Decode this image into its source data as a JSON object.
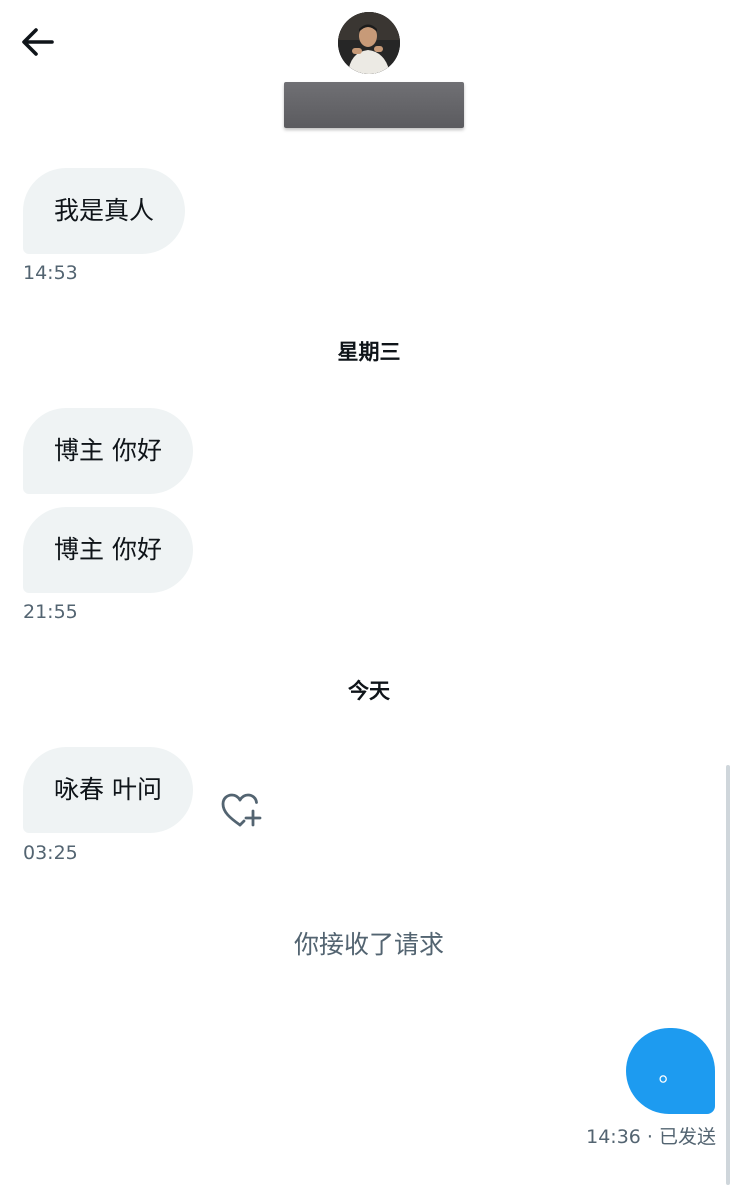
{
  "header": {
    "back_icon": "arrow-left-icon",
    "avatar_icon": "user-avatar"
  },
  "messages": {
    "m1": {
      "text": "我是真人",
      "time": "14:53"
    },
    "sep1": "星期三",
    "m2": {
      "text": "博主 你好"
    },
    "m3": {
      "text": "博主 你好",
      "time": "21:55"
    },
    "sep2": "今天",
    "m4": {
      "text": "咏春 叶问",
      "time": "03:25"
    },
    "system": "你接收了请求",
    "sent": {
      "text": "。",
      "meta": "14:36 · 已发送"
    }
  },
  "colors": {
    "accent": "#1d9bf0",
    "bubble_in": "#eff3f4",
    "muted_text": "#536471"
  }
}
